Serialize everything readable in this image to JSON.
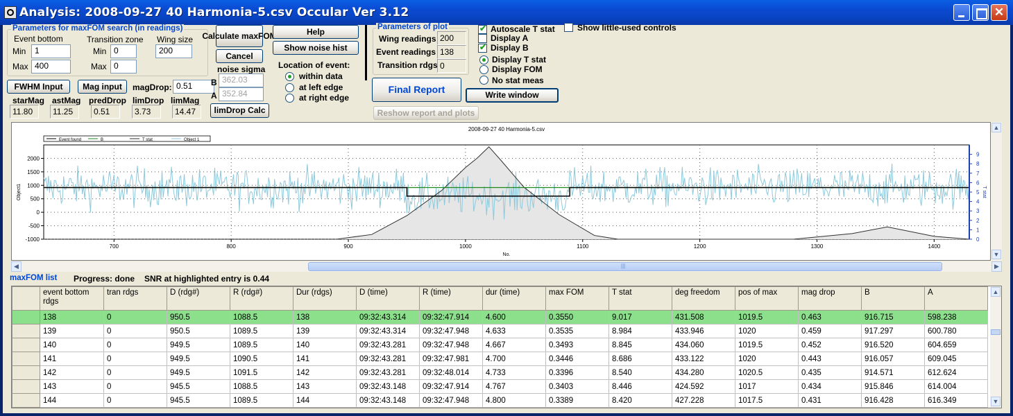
{
  "window": {
    "title": "Analysis: 2008-09-27 40 Harmonia-5.csv  Occular Ver 3.12",
    "close_glyph": "✕"
  },
  "maxfom_params": {
    "group_label": "Parameters for maxFOM search (in readings)",
    "event_bottom_label": "Event bottom",
    "min_label": "Min",
    "max_label": "Max",
    "event_min": "1",
    "event_max": "400",
    "transition_zone_label": "Transition zone",
    "tz_min": "0",
    "tz_max": "0",
    "wing_size_label": "Wing size",
    "wing_size": "200"
  },
  "buttons": {
    "calc_maxfom": "Calculate maxFOM",
    "cancel": "Cancel",
    "help": "Help",
    "show_noise_hist": "Show noise hist",
    "fwhm_input": "FWHM Input",
    "mag_input": "Mag input",
    "limdrop_calc": "limDrop Calc",
    "final_report": "Final Report",
    "write_window": "Write window",
    "reshow": "Reshow report and plots"
  },
  "mag": {
    "magdrop_label": "magDrop:",
    "magdrop": "0.51",
    "labels": [
      "starMag",
      "astMag",
      "predDrop",
      "limDrop",
      "limMag"
    ],
    "values": [
      "11.80",
      "11.25",
      "0.51",
      "3.73",
      "14.47"
    ]
  },
  "noise_sigma": {
    "label": "noise sigma",
    "b_label": "B",
    "b_value": "362.03",
    "a_label": "A",
    "a_value": "352.84"
  },
  "location": {
    "label": "Location of event:",
    "options": [
      "within data",
      "at left edge",
      "at right edge"
    ],
    "selected": 0
  },
  "plot_params": {
    "group_label": "Parameters of plot",
    "wing_readings_label": "Wing readings",
    "wing_readings": "200",
    "event_readings_label": "Event readings",
    "event_readings": "138",
    "transition_label": "Transition rdgs",
    "transition": "0"
  },
  "display": {
    "autoscale": "Autoscale T stat",
    "display_a": "Display A",
    "display_b": "Display B",
    "display_t": "Display T stat",
    "display_fom": "Display FOM",
    "no_stat": "No stat meas",
    "show_little_used": "Show little-used controls"
  },
  "chart_data": {
    "type": "line",
    "title": "2008-09-27 40 Harmonia-5.csv",
    "xlabel": "No.",
    "ylabel": "Object1",
    "y2label": "T stat",
    "xlim": [
      640,
      1430
    ],
    "ylim": [
      -1000,
      2500
    ],
    "y2lim": [
      0,
      10
    ],
    "xticks": [
      700,
      800,
      900,
      1000,
      1100,
      1200,
      1300,
      1400
    ],
    "yticks": [
      -1000,
      -500,
      0,
      500,
      1000,
      1500,
      2000
    ],
    "y2ticks": [
      0,
      1,
      2,
      3,
      4,
      5,
      6,
      7,
      8,
      9
    ],
    "legend": [
      "Event found",
      "B",
      "T stat",
      "Object 1"
    ],
    "legend_position": "top-left",
    "grid": true,
    "series": [
      {
        "name": "Event found",
        "color": "#000000",
        "x": [
          640,
          950,
          950,
          1089,
          1089,
          1430
        ],
        "y": [
          917,
          917,
          598,
          598,
          917,
          917
        ]
      },
      {
        "name": "B",
        "color": "#1b8a1b",
        "x": [
          640,
          1430
        ],
        "y": [
          917,
          917
        ]
      },
      {
        "name": "T stat",
        "color": "#303030",
        "x": [
          890,
          920,
          950,
          980,
          1000,
          1010,
          1020,
          1030,
          1050,
          1080,
          1110,
          1130,
          1280,
          1330,
          1360,
          1400,
          1430
        ],
        "y": [
          0,
          0.5,
          2.5,
          5.2,
          7.6,
          8.6,
          9.8,
          8.4,
          5.5,
          2.6,
          0.4,
          0,
          0,
          0.6,
          1.3,
          0.3,
          0
        ]
      },
      {
        "name": "Object 1",
        "color": "#8ec9dc",
        "x_start": 640,
        "x_end": 1430,
        "event_x": [
          950,
          1089
        ],
        "level_outside": 917,
        "level_inside": 598,
        "noise_sigma": 360
      }
    ]
  },
  "scrollbar": {
    "grip": "|||"
  },
  "list": {
    "title": "maxFOM list",
    "progress": "Progress: done",
    "snr": "SNR at highlighted entry is 0.44",
    "columns": [
      "event bottom rdgs",
      "tran rdgs",
      "D (rdg#)",
      "R (rdg#)",
      "Dur (rdgs)",
      "D (time)",
      "R (time)",
      "dur (time)",
      "max FOM",
      "T stat",
      "deg freedom",
      "pos of max",
      "mag drop",
      "B",
      "A"
    ],
    "rows": [
      [
        "138",
        "0",
        "950.5",
        "1088.5",
        "138",
        "09:32:43.314",
        "09:32:47.914",
        "4.600",
        "0.3550",
        "9.017",
        "431.508",
        "1019.5",
        "0.463",
        "916.715",
        "598.238"
      ],
      [
        "139",
        "0",
        "950.5",
        "1089.5",
        "139",
        "09:32:43.314",
        "09:32:47.948",
        "4.633",
        "0.3535",
        "8.984",
        "433.946",
        "1020",
        "0.459",
        "917.297",
        "600.780"
      ],
      [
        "140",
        "0",
        "949.5",
        "1089.5",
        "140",
        "09:32:43.281",
        "09:32:47.948",
        "4.667",
        "0.3493",
        "8.845",
        "434.060",
        "1019.5",
        "0.452",
        "916.520",
        "604.659"
      ],
      [
        "141",
        "0",
        "949.5",
        "1090.5",
        "141",
        "09:32:43.281",
        "09:32:47.981",
        "4.700",
        "0.3446",
        "8.686",
        "433.122",
        "1020",
        "0.443",
        "916.057",
        "609.045"
      ],
      [
        "142",
        "0",
        "949.5",
        "1091.5",
        "142",
        "09:32:43.281",
        "09:32:48.014",
        "4.733",
        "0.3396",
        "8.540",
        "434.280",
        "1020.5",
        "0.435",
        "914.571",
        "612.624"
      ],
      [
        "143",
        "0",
        "945.5",
        "1088.5",
        "143",
        "09:32:43.148",
        "09:32:47.914",
        "4.767",
        "0.3403",
        "8.446",
        "424.592",
        "1017",
        "0.434",
        "915.846",
        "614.004"
      ],
      [
        "144",
        "0",
        "945.5",
        "1089.5",
        "144",
        "09:32:43.148",
        "09:32:47.948",
        "4.800",
        "0.3389",
        "8.420",
        "427.228",
        "1017.5",
        "0.431",
        "916.428",
        "616.349"
      ]
    ],
    "highlighted": 0
  }
}
